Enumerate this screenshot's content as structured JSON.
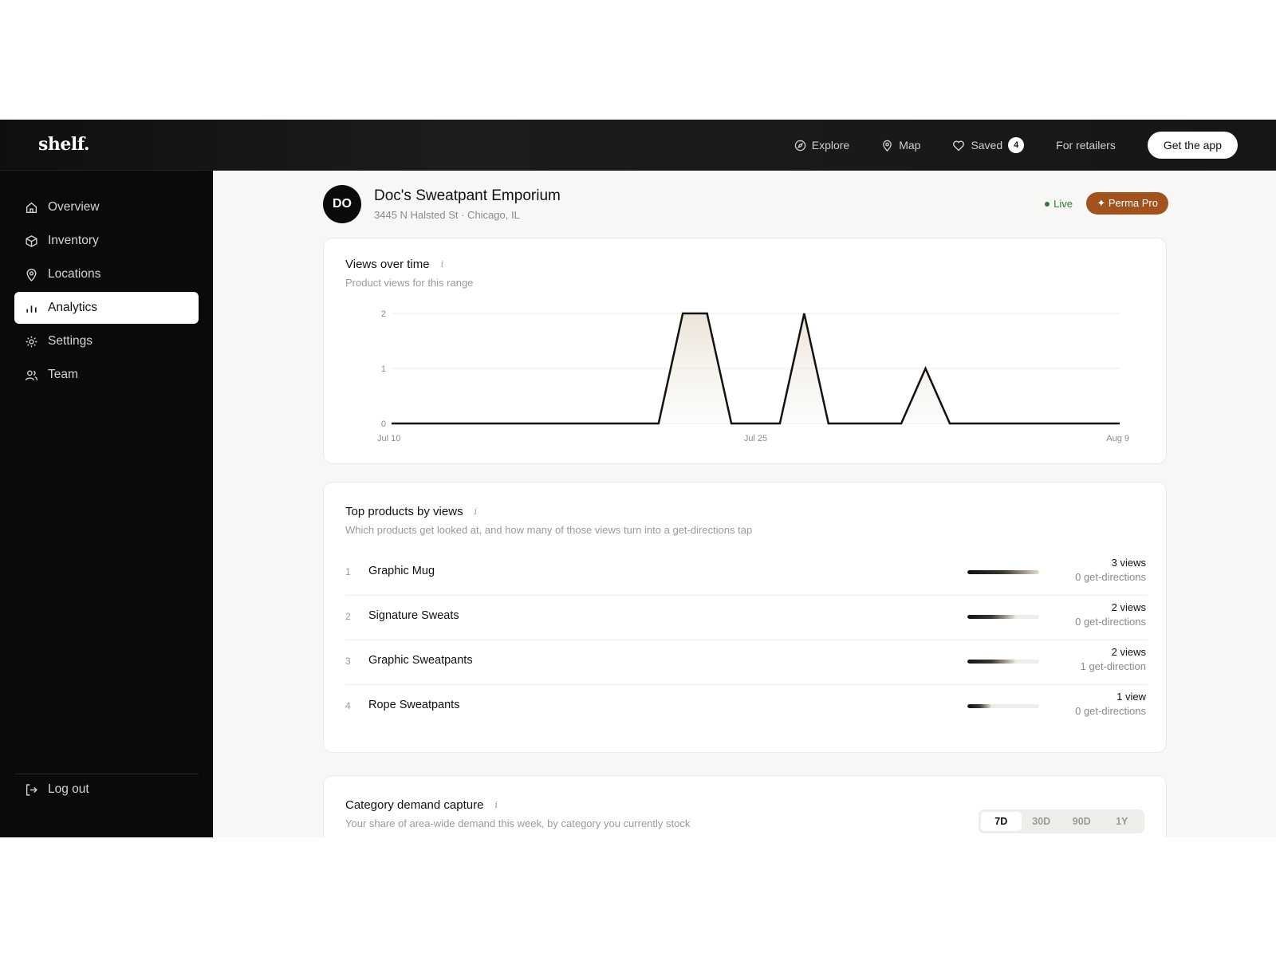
{
  "brand": {
    "logo": "shelf."
  },
  "nav": {
    "explore": "Explore",
    "map": "Map",
    "saved": "Saved",
    "saved_count": "4",
    "retailers": "For retailers",
    "get_app": "Get the app"
  },
  "sidebar": {
    "items": [
      {
        "label": "Overview",
        "icon": "home-icon"
      },
      {
        "label": "Inventory",
        "icon": "box-icon"
      },
      {
        "label": "Locations",
        "icon": "pin-icon"
      },
      {
        "label": "Analytics",
        "icon": "bar-chart-icon",
        "active": true
      },
      {
        "label": "Settings",
        "icon": "gear-icon"
      },
      {
        "label": "Team",
        "icon": "users-icon"
      }
    ],
    "logout": "Log out"
  },
  "store": {
    "initials": "DO",
    "name": "Doc's Sweatpant Emporium",
    "address": "3445 N Halsted St · Chicago, IL",
    "status": "Live",
    "plan": "✦ Perma Pro"
  },
  "views_card": {
    "title": "Views over time",
    "info": "i",
    "subtitle": "Product views for this range"
  },
  "chart_data": {
    "type": "area",
    "x": [
      "Jul 10",
      "Jul 11",
      "Jul 12",
      "Jul 13",
      "Jul 14",
      "Jul 15",
      "Jul 16",
      "Jul 17",
      "Jul 18",
      "Jul 19",
      "Jul 20",
      "Jul 21",
      "Jul 22",
      "Jul 23",
      "Jul 24",
      "Jul 25",
      "Jul 26",
      "Jul 27",
      "Jul 28",
      "Jul 29",
      "Jul 30",
      "Jul 31",
      "Aug 1",
      "Aug 2",
      "Aug 3",
      "Aug 4",
      "Aug 5",
      "Aug 6",
      "Aug 7",
      "Aug 8",
      "Aug 9"
    ],
    "values": [
      0,
      0,
      0,
      0,
      0,
      0,
      0,
      0,
      0,
      0,
      0,
      0,
      2,
      2,
      0,
      0,
      0,
      2,
      0,
      0,
      0,
      0,
      1,
      0,
      0,
      0,
      0,
      0,
      0,
      0,
      0
    ],
    "y_ticks": [
      "0",
      "1",
      "2"
    ],
    "x_ticks": [
      "Jul 10",
      "Jul 25",
      "Aug 9"
    ],
    "ylim": [
      0,
      2
    ],
    "grid": true
  },
  "products_card": {
    "title": "Top products by views",
    "info": "i",
    "subtitle": "Which products get looked at, and how many of those views turn into a get-directions tap",
    "rows": [
      {
        "rank": "1",
        "name": "Graphic Mug",
        "views": "3 views",
        "directions": "0 get-directions",
        "share": 1.0
      },
      {
        "rank": "2",
        "name": "Signature Sweats",
        "views": "2 views",
        "directions": "0 get-directions",
        "share": 0.667
      },
      {
        "rank": "3",
        "name": "Graphic Sweatpants",
        "views": "2 views",
        "directions": "1 get-direction",
        "share": 0.667
      },
      {
        "rank": "4",
        "name": "Rope Sweatpants",
        "views": "1 view",
        "directions": "0 get-directions",
        "share": 0.333
      }
    ]
  },
  "category_card": {
    "title": "Category demand capture",
    "info": "i",
    "subtitle": "Your share of area-wide demand this week, by category you currently stock",
    "ranges": [
      "7D",
      "30D",
      "90D",
      "1Y"
    ],
    "active_range": "7D"
  },
  "colors": {
    "accent": "#a2521d",
    "live": "#2f7d32",
    "topbar": "#141414",
    "sidebar": "#0a0a0a"
  }
}
